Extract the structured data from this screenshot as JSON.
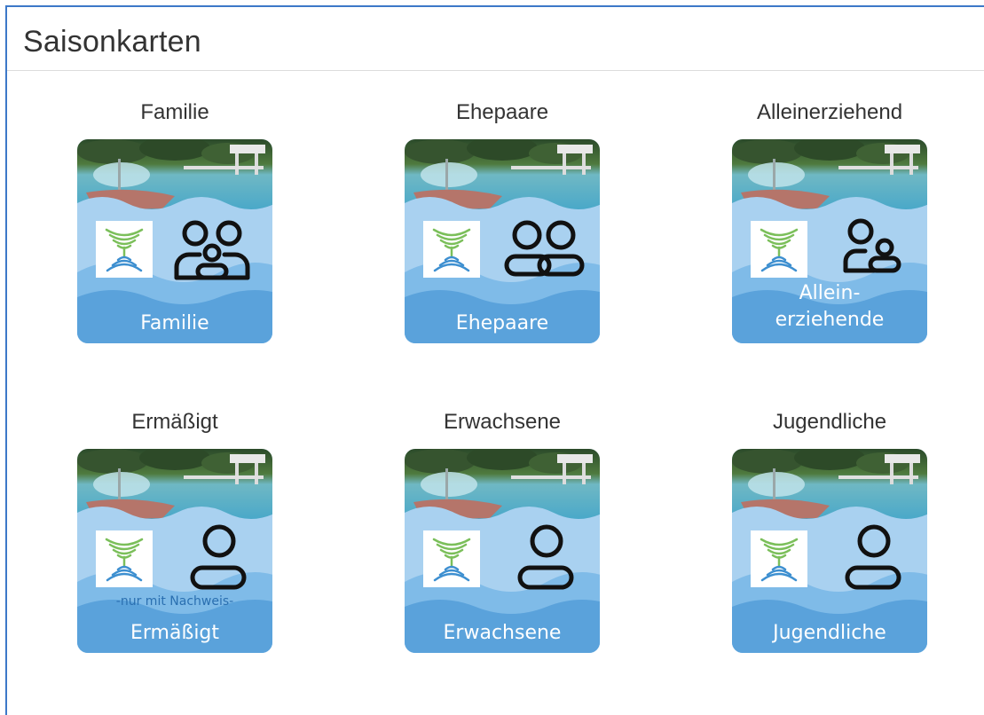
{
  "panel": {
    "title": "Saisonkarten"
  },
  "cards": [
    {
      "caption": "Familie",
      "label_lines": [
        "Familie"
      ],
      "note": "",
      "people": "family"
    },
    {
      "caption": "Ehepaare",
      "label_lines": [
        "Ehepaare"
      ],
      "note": "",
      "people": "couple"
    },
    {
      "caption": "Alleinerziehend",
      "label_lines": [
        "Allein-",
        "erziehende"
      ],
      "note": "",
      "people": "single-parent"
    },
    {
      "caption": "Ermäßigt",
      "label_lines": [
        "Ermäßigt"
      ],
      "note": "-nur mit Nachweis-",
      "people": "single"
    },
    {
      "caption": "Erwachsene",
      "label_lines": [
        "Erwachsene"
      ],
      "note": "",
      "people": "single"
    },
    {
      "caption": "Jugendliche",
      "label_lines": [
        "Jugendliche"
      ],
      "note": "",
      "people": "single"
    }
  ],
  "colors": {
    "border_accent": "#3c78c8",
    "water_light": "#a9d1f0",
    "water_mid": "#7fbbe8",
    "water_dark": "#5aa2db",
    "label_text": "#ffffff",
    "note_text": "#2a6fb0",
    "logo_green": "#7bbf5a",
    "logo_blue": "#3d8fd0"
  }
}
